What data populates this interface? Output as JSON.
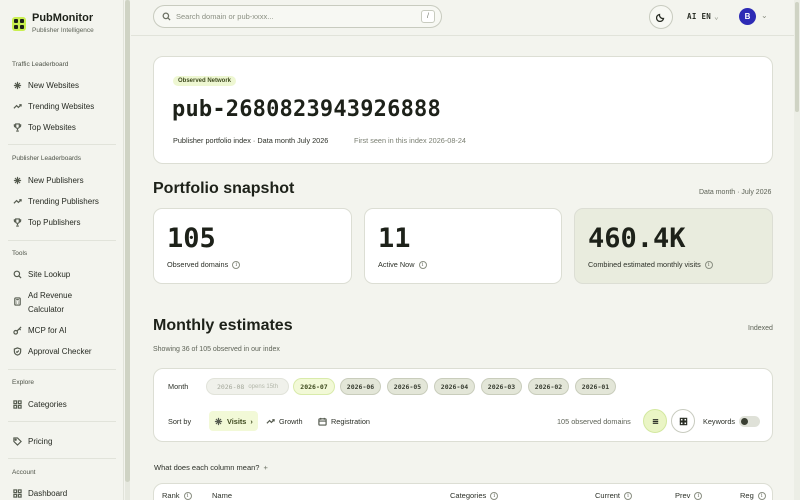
{
  "brand": {
    "name": "PubMonitor",
    "tagline": "Publisher Intelligence"
  },
  "sidebar": {
    "sections": [
      {
        "title": "Traffic Leaderboard",
        "items": [
          {
            "label": "New Websites",
            "icon": "sparkle-icon"
          },
          {
            "label": "Trending Websites",
            "icon": "trend-icon"
          },
          {
            "label": "Top Websites",
            "icon": "trophy-icon"
          }
        ]
      },
      {
        "title": "Publisher Leaderboards",
        "items": [
          {
            "label": "New Publishers",
            "icon": "sparkle-icon"
          },
          {
            "label": "Trending Publishers",
            "icon": "trend-icon"
          },
          {
            "label": "Top Publishers",
            "icon": "trophy-icon"
          }
        ]
      },
      {
        "title": "Tools",
        "items": [
          {
            "label": "Site Lookup",
            "icon": "search-icon"
          },
          {
            "label": "Ad Revenue",
            "label2": "Calculator",
            "icon": "calculator-icon"
          },
          {
            "label": "MCP for AI",
            "icon": "key-icon"
          },
          {
            "label": "Approval Checker",
            "icon": "shield-icon"
          }
        ]
      },
      {
        "title": "Explore",
        "items": [
          {
            "label": "Categories",
            "icon": "grid-icon"
          }
        ]
      },
      {
        "title": "",
        "items": [
          {
            "label": "Pricing",
            "icon": "tag-icon"
          }
        ]
      },
      {
        "title": "Account",
        "items": [
          {
            "label": "Dashboard",
            "icon": "grid-icon"
          }
        ]
      }
    ]
  },
  "topbar": {
    "search_placeholder": "Search domain or pub-xxxx...",
    "search_shortcut": "/",
    "language": "AI EN",
    "avatar_initial": "B"
  },
  "hero": {
    "badge": "Observed Network",
    "publisher_id": "pub-2680823943926888",
    "meta": "Publisher portfolio index · Data month July 2026",
    "first_seen": "First seen in this index 2026-08-24"
  },
  "snapshot": {
    "title": "Portfolio snapshot",
    "note": "Data month · July 2026",
    "stats": [
      {
        "value": "105",
        "label": "Observed domains"
      },
      {
        "value": "11",
        "label": "Active Now"
      },
      {
        "value": "460.4K",
        "label": "Combined estimated monthly visits"
      }
    ]
  },
  "monthly": {
    "title": "Monthly estimates",
    "note": "Indexed",
    "showing": "Showing 36 of 105 observed in our index",
    "month_label": "Month",
    "months": [
      {
        "label": "2026-08",
        "extra": "opens 15th",
        "state": "disabled"
      },
      {
        "label": "2026-07",
        "state": "selected"
      },
      {
        "label": "2026-06",
        "state": "normal"
      },
      {
        "label": "2026-05",
        "state": "normal"
      },
      {
        "label": "2026-04",
        "state": "normal"
      },
      {
        "label": "2026-03",
        "state": "normal"
      },
      {
        "label": "2026-02",
        "state": "normal"
      },
      {
        "label": "2026-01",
        "state": "normal"
      }
    ],
    "sort_label": "Sort by",
    "sort_options": [
      "Visits",
      "Growth",
      "Registration"
    ],
    "observed_count": "105 observed domains",
    "keywords_label": "Keywords",
    "column_help": "What does each column mean?"
  },
  "table": {
    "columns": [
      "Rank",
      "Name",
      "Categories",
      "Current",
      "Prev",
      "Reg"
    ]
  },
  "colors": {
    "accent": "#c9ef4f",
    "avatar": "#2d2bb5",
    "background": "#f3f4ee"
  }
}
